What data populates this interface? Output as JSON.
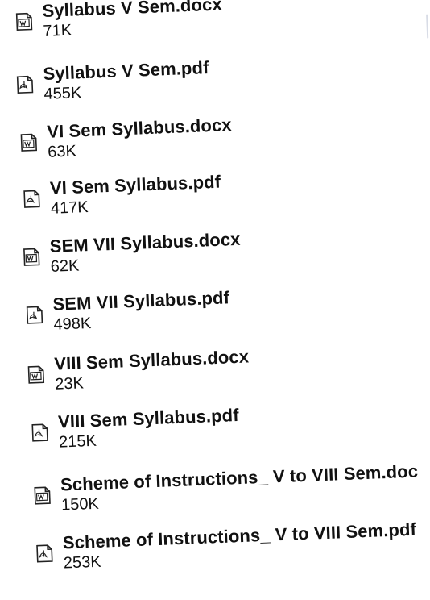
{
  "files": [
    {
      "name": "Syllabus V Sem.docx",
      "size": "71K",
      "type": "word",
      "icon": "word-document-icon"
    },
    {
      "name": "Syllabus V Sem.pdf",
      "size": "455K",
      "type": "pdf",
      "icon": "pdf-document-icon"
    },
    {
      "name": "VI Sem Syllabus.docx",
      "size": "63K",
      "type": "word",
      "icon": "word-document-icon"
    },
    {
      "name": "VI Sem Syllabus.pdf",
      "size": "417K",
      "type": "pdf",
      "icon": "pdf-document-icon"
    },
    {
      "name": "SEM VII Syllabus.docx",
      "size": "62K",
      "type": "word",
      "icon": "word-document-icon"
    },
    {
      "name": "SEM VII Syllabus.pdf",
      "size": "498K",
      "type": "pdf",
      "icon": "pdf-document-icon"
    },
    {
      "name": "VIII Sem Syllabus.docx",
      "size": "23K",
      "type": "word",
      "icon": "word-document-icon"
    },
    {
      "name": "VIII Sem Syllabus.pdf",
      "size": "215K",
      "type": "pdf",
      "icon": "pdf-document-icon"
    },
    {
      "name": "Scheme of Instructions_ V to VIII Sem.doc",
      "size": "150K",
      "type": "word",
      "icon": "word-document-icon"
    },
    {
      "name": "Scheme of Instructions_ V to VIII Sem.pdf",
      "size": "253K",
      "type": "pdf",
      "icon": "pdf-document-icon"
    }
  ]
}
